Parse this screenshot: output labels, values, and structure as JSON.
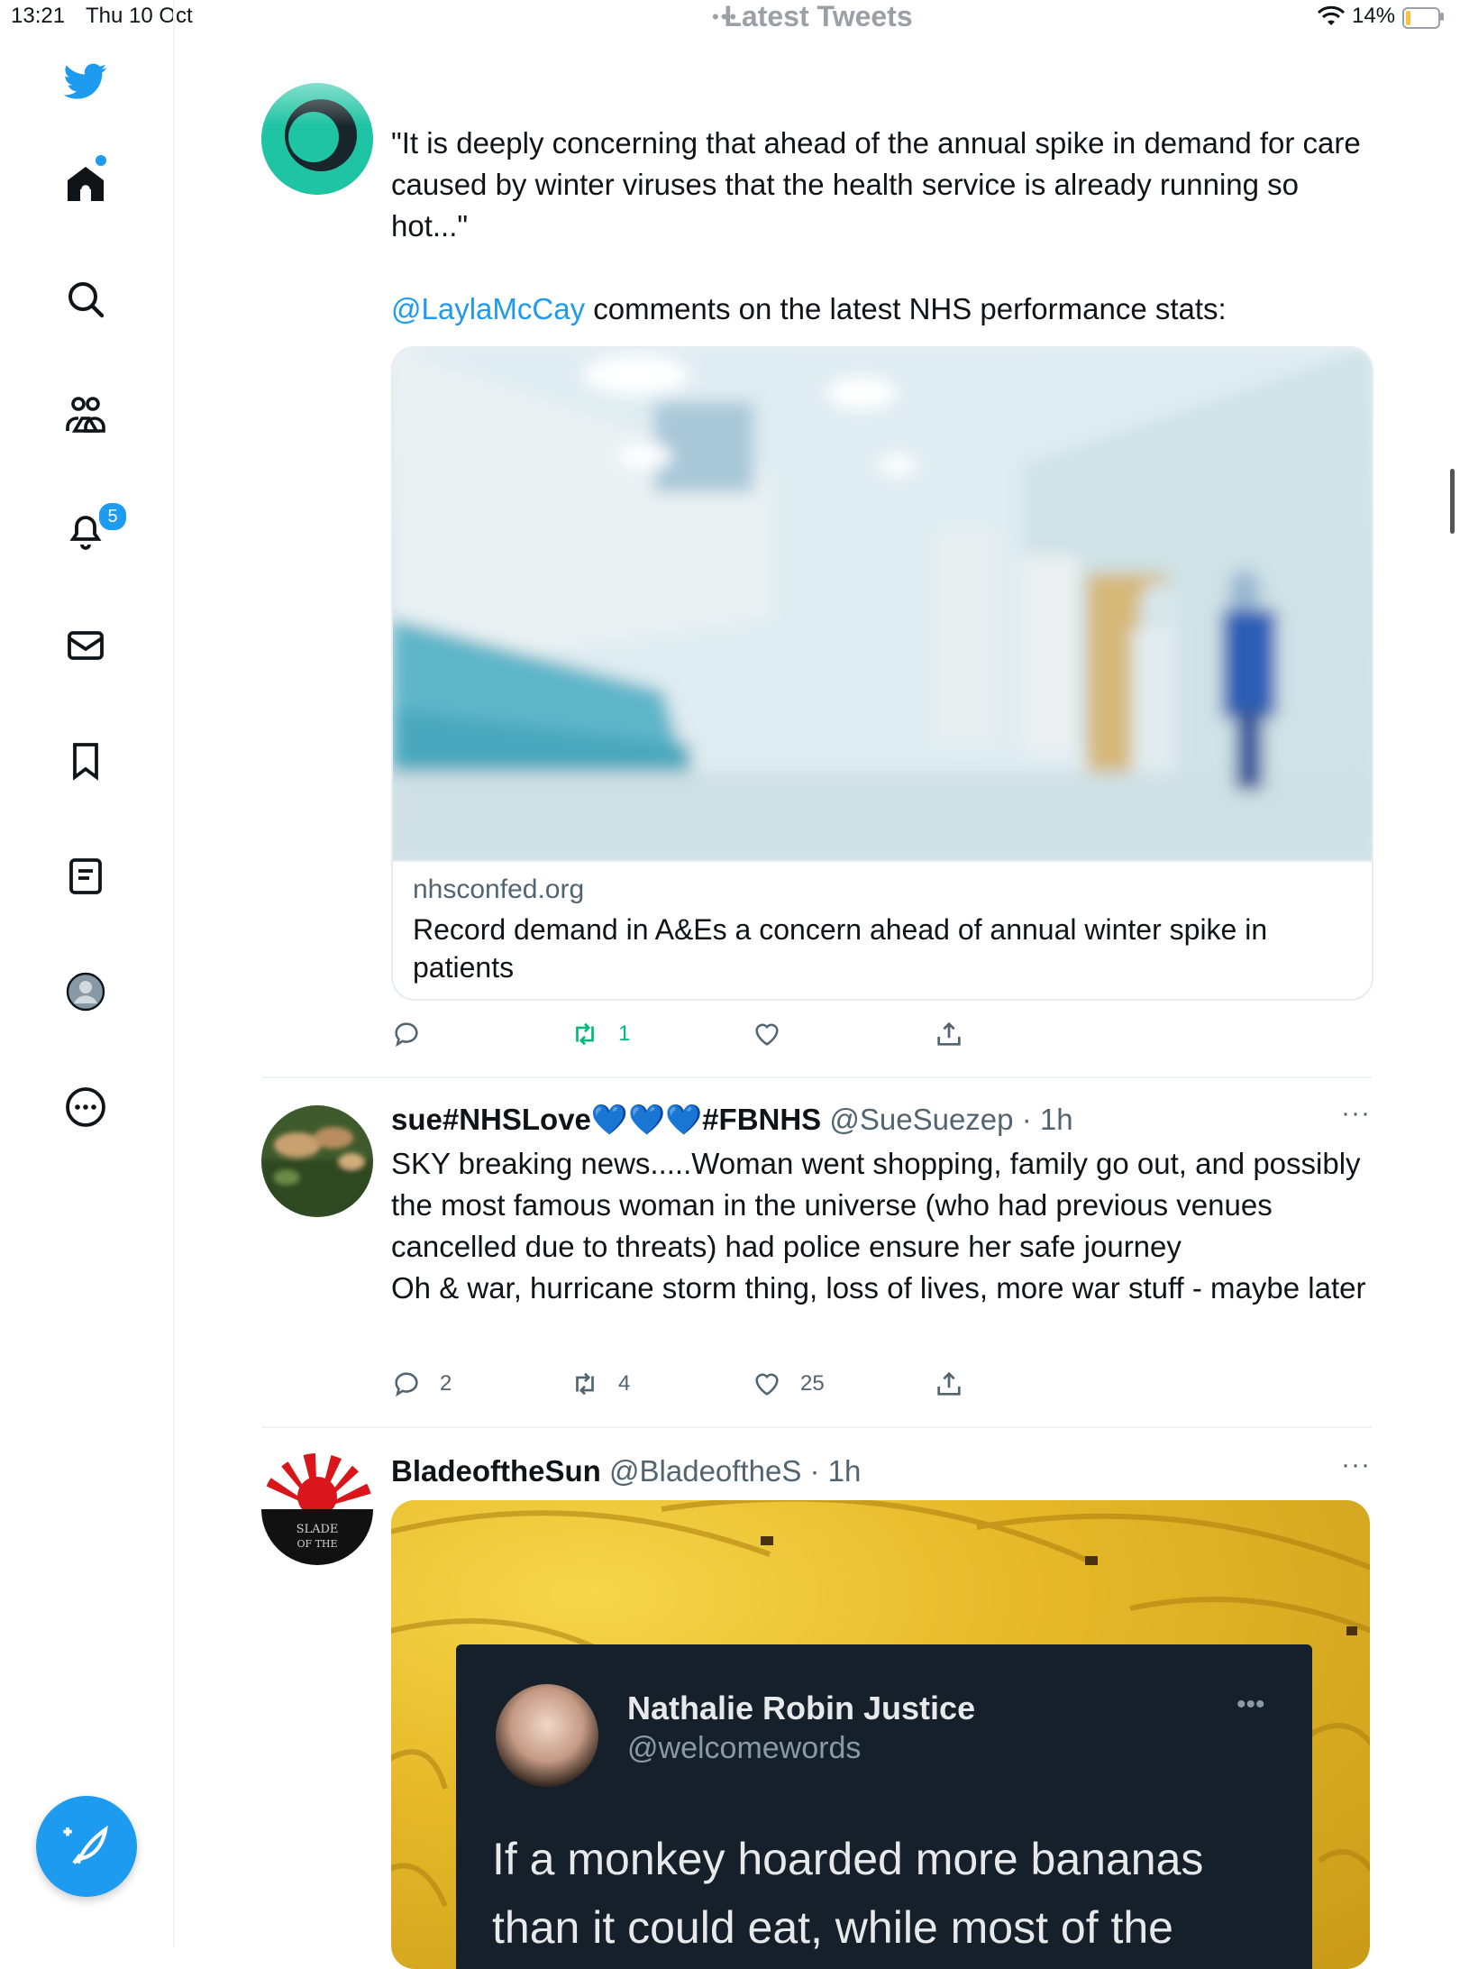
{
  "status_bar": {
    "time": "13:21",
    "date": "Thu 10 Oct",
    "title": "Latest Tweets",
    "battery": "14%"
  },
  "sidebar": {
    "notifications_badge": "5"
  },
  "tweets": [
    {
      "text": "\"It is deeply concerning that ahead of the annual spike in demand for care caused by winter viruses that the health service is already running so hot...\"",
      "mention": "@LaylaMcCay",
      "text2": " comments on the latest NHS performance stats:",
      "card": {
        "domain": "nhsconfed.org",
        "title": "Record demand in A&Es a concern ahead of annual winter spike in patients"
      },
      "actions": {
        "replies": "",
        "retweets": "1",
        "likes": ""
      }
    },
    {
      "name": "sue#NHSLove💙💙💙#FBNHS",
      "handle": "@SueSuezep",
      "time": "· 1h",
      "text": "SKY breaking news.....Woman went shopping, family go out, and possibly the most famous woman in the universe (who had previous venues cancelled due to threats) had police ensure her safe journey\nOh & war, hurricane storm thing, loss of lives, more war stuff - maybe later",
      "actions": {
        "replies": "2",
        "retweets": "4",
        "likes": "25"
      }
    },
    {
      "name": "BladeoftheSun",
      "handle": "@BladeoftheS",
      "time": "· 1h",
      "quote": {
        "name": "Nathalie Robin Justice",
        "handle": "@welcomewords",
        "text": "If a monkey hoarded more bananas than it could eat, while most of the"
      }
    }
  ],
  "colors": {
    "accent": "#1d9bf0",
    "retweet_green": "#00ba7c",
    "muted": "#536471"
  }
}
